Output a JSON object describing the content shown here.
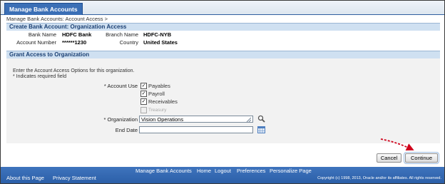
{
  "tab": {
    "label": "Manage Bank Accounts"
  },
  "breadcrumb": {
    "text": "Manage Bank Accounts: Account Access",
    "sep": ">"
  },
  "org_section": {
    "title": "Create Bank Account: Organization Access",
    "bank_name_label": "Bank Name",
    "bank_name": "HDFC Bank",
    "branch_name_label": "Branch Name",
    "branch_name": "HDFC-NYB",
    "account_number_label": "Account Number",
    "account_number": "******1230",
    "country_label": "Country",
    "country": "United States"
  },
  "grant_section": {
    "title": "Grant Access to Organization",
    "instructions": "Enter the Account Access Options for this organization.",
    "required_note": "* Indicates required field",
    "account_use_label": "Account Use",
    "required_star": "*",
    "options": [
      {
        "label": "Payables",
        "checked": true,
        "disabled": false
      },
      {
        "label": "Payroll",
        "checked": true,
        "disabled": false
      },
      {
        "label": "Receivables",
        "checked": true,
        "disabled": false
      },
      {
        "label": "Treasury",
        "checked": false,
        "disabled": true
      }
    ],
    "organization_label": "Organization",
    "organization_value": "Vision Operations",
    "end_date_label": "End Date",
    "end_date_value": ""
  },
  "buttons": {
    "cancel": "Cancel",
    "continue": "Continue"
  },
  "footer": {
    "links": [
      "Manage Bank Accounts",
      "Home",
      "Logout",
      "Preferences",
      "Personalize Page"
    ],
    "about": "About this Page",
    "privacy": "Privacy Statement",
    "copyright": "Copyright (c) 1998, 2013, Oracle and/or its affiliates. All rights reserved."
  },
  "colors": {
    "accent": "#3b6fb6",
    "section_header": "#cfe0f1",
    "annotation_arrow": "#d0021b"
  }
}
